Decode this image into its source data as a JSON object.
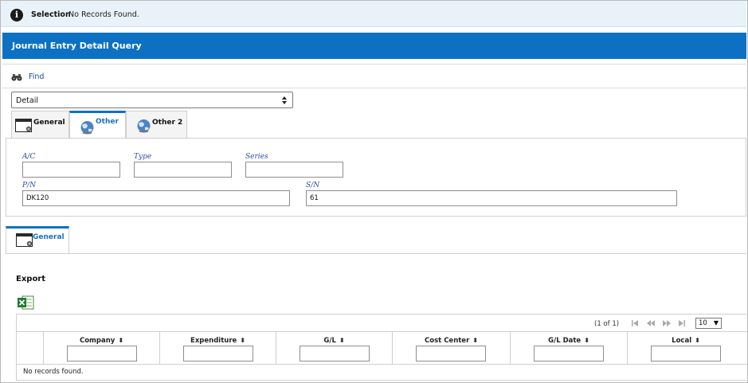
{
  "message": {
    "label": "Selection",
    "text": "No Records Found."
  },
  "title": "Journal Entry Detail Query",
  "toolbar": {
    "find_label": "Find"
  },
  "view_select": {
    "value": "Detail"
  },
  "tabs": [
    {
      "label": "General",
      "active": false
    },
    {
      "label": "Other",
      "active": true
    },
    {
      "label": "Other 2",
      "active": false
    }
  ],
  "fields": {
    "ac": {
      "label": "A/C",
      "value": ""
    },
    "type": {
      "label": "Type",
      "value": ""
    },
    "series": {
      "label": "Series",
      "value": ""
    },
    "pn": {
      "label": "P/N",
      "value": "DK120"
    },
    "sn": {
      "label": "S/N",
      "value": "61"
    }
  },
  "lower_tab": {
    "label": "General"
  },
  "export": {
    "title": "Export",
    "icon": "excel-icon"
  },
  "grid": {
    "pager_text": "(1 of 1)",
    "rows_per_page": "10",
    "columns": [
      "Company",
      "Expenditure",
      "G/L",
      "Cost Center",
      "G/L Date",
      "Local"
    ],
    "empty_text": "No records found."
  },
  "colors": {
    "accent": "#0c71c3",
    "message_bg": "#e8f2f8",
    "label_blue": "#2a4fa6"
  }
}
